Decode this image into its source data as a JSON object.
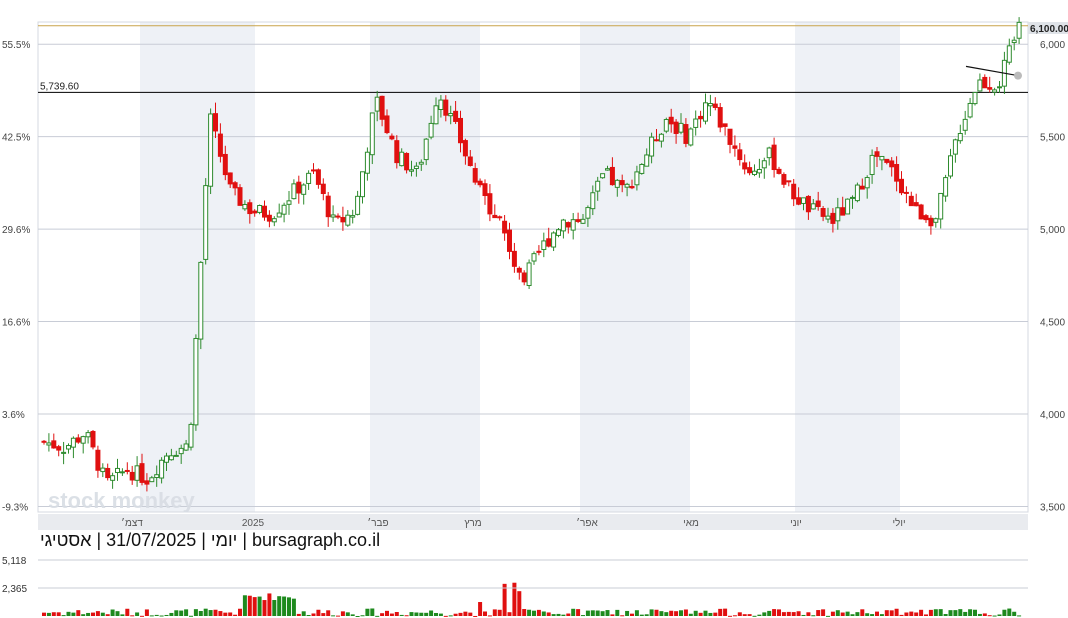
{
  "caption": "יומי | 31/07/2025 | אסטיגי | bursagraph.co.il",
  "watermark": "stock monkey",
  "colors": {
    "up": "#2e8b2e",
    "down": "#e01010",
    "grid": "#c8ccd6",
    "band": "#eef1f6",
    "resistance": "#c9a44a"
  },
  "chart_data": {
    "type": "candlestick",
    "price_axis": {
      "ticks": [
        "3,500",
        "4,000",
        "4,500",
        "5,000",
        "5,500",
        "6,000"
      ],
      "range": [
        3470,
        6120
      ]
    },
    "percent_axis": {
      "ticks": [
        "-9.3%",
        "3.6%",
        "16.6%",
        "29.6%",
        "42.5%",
        "55.5%"
      ]
    },
    "months": [
      "דצמ׳",
      "2025",
      "פבר׳",
      "מרץ",
      "אפר׳",
      "מאי",
      "יוני",
      "יולי"
    ],
    "last_price_label": "6,100.00",
    "horizontal_lines": [
      {
        "label": "5,739.60",
        "value": 5739.6
      },
      {
        "label": "",
        "value": 6100
      }
    ],
    "volume": {
      "ticks": [
        "5,118",
        "2,365"
      ],
      "max": 5118
    },
    "key_points": [
      {
        "date": "2024-11",
        "price": 3850
      },
      {
        "date": "2024-12",
        "price": 3600
      },
      {
        "date": "2025-01",
        "price": 5650
      },
      {
        "date": "2025-02",
        "price": 5050
      },
      {
        "date": "2025-03",
        "price": 5800
      },
      {
        "date": "2025-04",
        "price": 4620
      },
      {
        "date": "2025-05",
        "price": 5100
      },
      {
        "date": "2025-06",
        "price": 5700
      },
      {
        "date": "2025-07",
        "price": 6100
      }
    ]
  }
}
